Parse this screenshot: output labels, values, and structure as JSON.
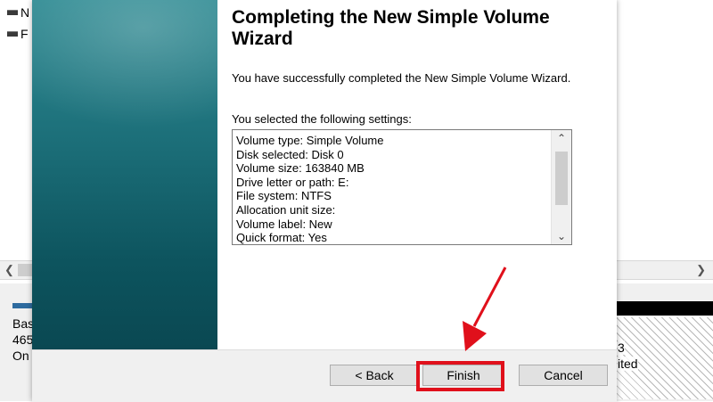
{
  "background": {
    "tree_items": [
      "N",
      "F"
    ],
    "disk_info_lines": [
      "Bas",
      "465",
      "On"
    ],
    "right_labels": [
      "3",
      "ited"
    ]
  },
  "wizard": {
    "title": "Completing the New Simple Volume Wizard",
    "description": "You have successfully completed the New Simple Volume Wizard.",
    "selected_label": "You selected the following settings:",
    "settings": [
      "Volume type: Simple Volume",
      "Disk selected: Disk 0",
      "Volume size: 163840 MB",
      "Drive letter or path: E:",
      "File system: NTFS",
      "Allocation unit size:",
      "Volume label: New",
      "Quick format: Yes"
    ],
    "buttons": {
      "back": "< Back",
      "finish": "Finish",
      "cancel": "Cancel"
    }
  },
  "annotation": {
    "highlight_color": "#e0101b"
  },
  "colors": {
    "panel_teal": "#1c6f79",
    "dialog_bg": "#f0f0f0"
  }
}
